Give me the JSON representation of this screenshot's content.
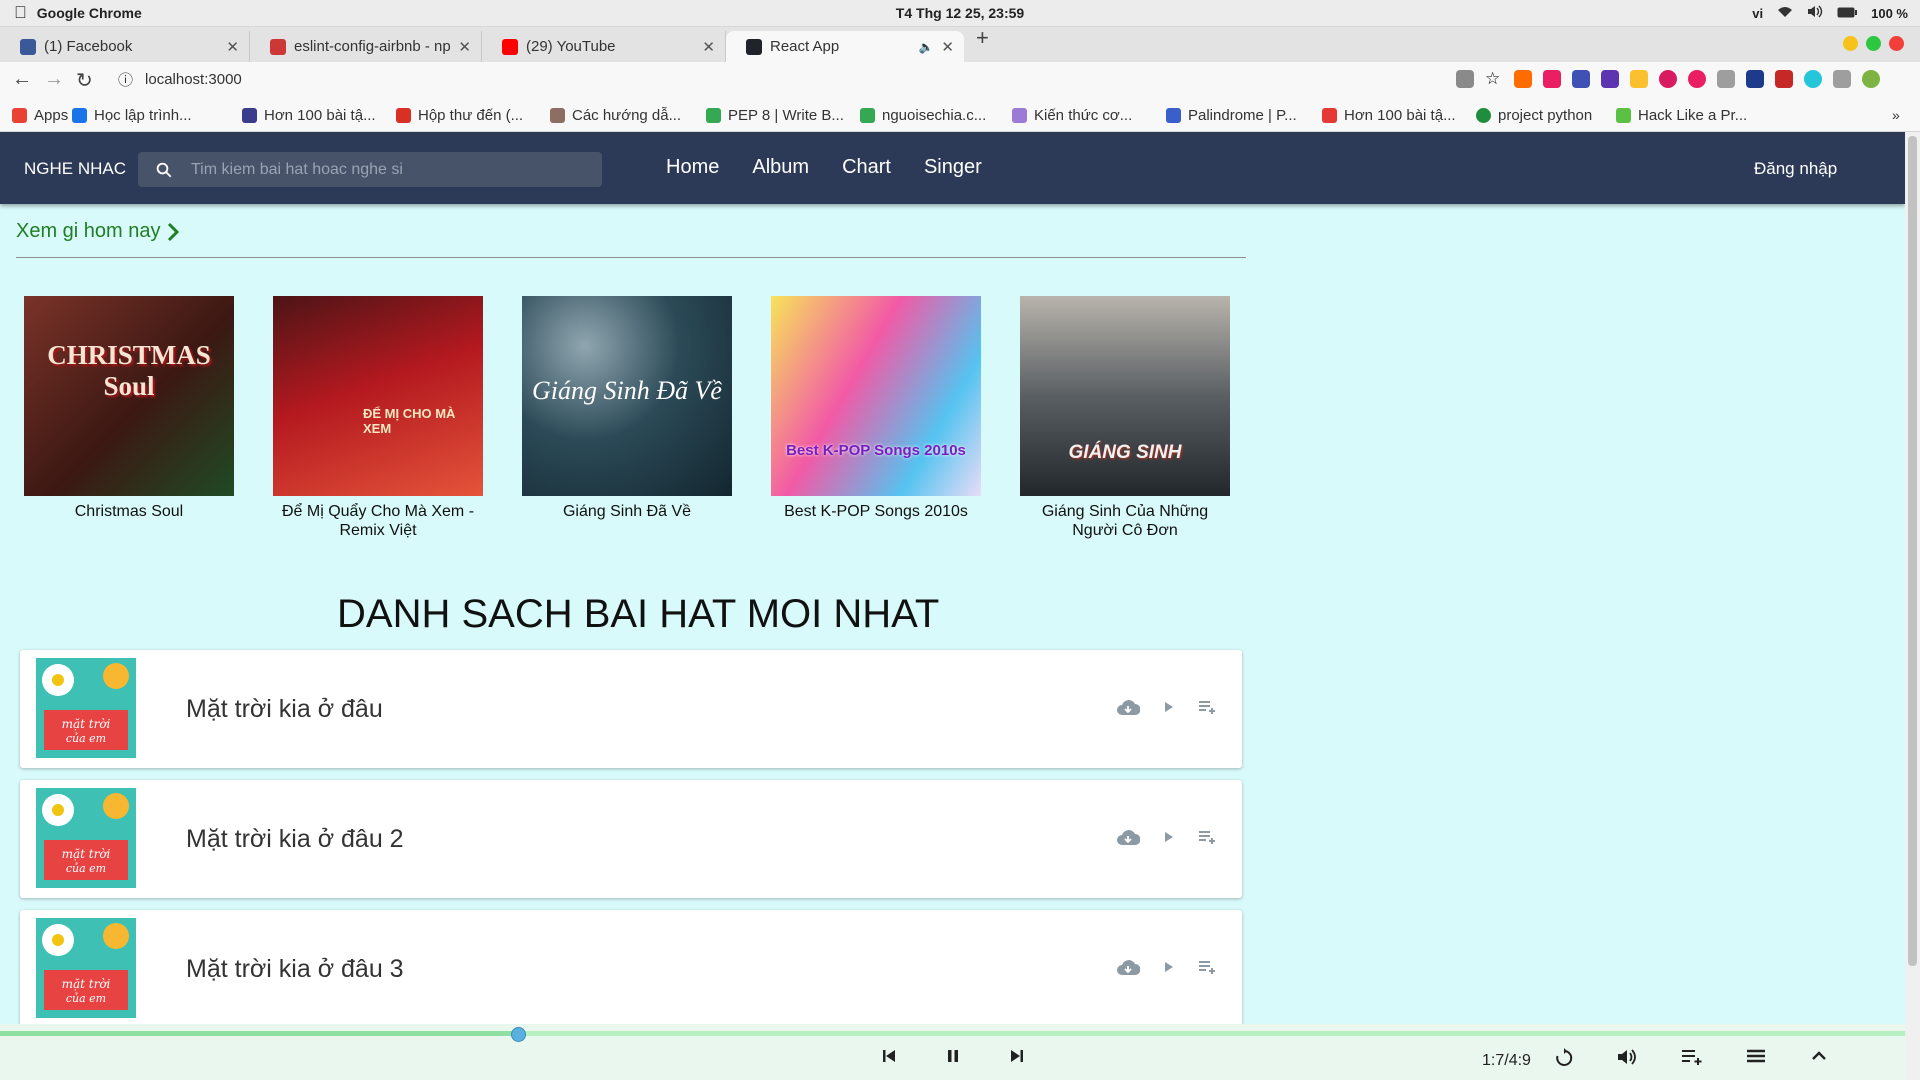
{
  "os": {
    "app_name": "Google Chrome",
    "clock": "T4 Thg 12 25, 23:59",
    "lang": "vi",
    "battery": "100 %"
  },
  "tabs": [
    {
      "label": "(1) Facebook",
      "color": "#3b5998"
    },
    {
      "label": "eslint-config-airbnb - npm",
      "color": "#cb3837"
    },
    {
      "label": "(29) YouTube",
      "color": "#ff0000"
    },
    {
      "label": "React App",
      "color": "#20232a"
    }
  ],
  "url": "localhost:3000",
  "bookmarks": [
    {
      "label": "Apps",
      "color": "#e94235"
    },
    {
      "label": "Học lập trình...",
      "color": "#1a73e8"
    },
    {
      "label": "Hơn 100 bài tậ...",
      "color": "#3c3c8c"
    },
    {
      "label": "Hộp thư đến (...",
      "color": "#d93025"
    },
    {
      "label": "Các hướng dẫ...",
      "color": "#8d6e63"
    },
    {
      "label": "PEP 8 | Write B...",
      "color": "#34a853"
    },
    {
      "label": "nguoisechia.c...",
      "color": "#34a853"
    },
    {
      "label": "Kiến thức cơ...",
      "color": "#9c7bd6"
    },
    {
      "label": "Palindrome | P...",
      "color": "#3b5fc9"
    },
    {
      "label": "Hơn 100 bài tậ...",
      "color": "#e53935"
    },
    {
      "label": "project python",
      "color": "#1e8e3e"
    },
    {
      "label": "Hack Like a Pr...",
      "color": "#5ac145"
    }
  ],
  "app": {
    "brand": "NGHE NHAC",
    "search_placeholder": "Tim kiem bai hat hoac nghe si",
    "nav": [
      "Home",
      "Album",
      "Chart",
      "Singer"
    ],
    "login": "Đăng nhập",
    "section_title": "Xem gi hom nay",
    "albums": [
      {
        "title": "Christmas Soul",
        "art_text": "CHRISTMAS Soul",
        "bg": "#6a2b22"
      },
      {
        "title": "Để Mị Quẩy Cho Mà Xem - Remix Việt",
        "art_text": "ĐỂ MỊ CHO MÀ XEM",
        "bg": "#a31b1f"
      },
      {
        "title": "Giáng Sinh Đã Về",
        "art_text": "Giáng Sinh Đã Về",
        "bg": "#1f3f4f"
      },
      {
        "title": "Best K-POP Songs 2010s",
        "art_text": "Best K-POP Songs 2010s",
        "bg": "#e9e2f2"
      },
      {
        "title": "Giáng Sinh Của Những Người Cô Đơn",
        "art_text": "GIÁNG SINH",
        "bg": "#40474d"
      }
    ],
    "list_title": "DANH SACH BAI HAT MOI NHAT",
    "songs": [
      {
        "name": "Mặt trời kia ở đâu"
      },
      {
        "name": "Mặt trời kia ở đâu 2"
      },
      {
        "name": "Mặt trời kia ở đâu 3"
      }
    ]
  },
  "player": {
    "time": "1:7/4:9",
    "progress": 0.272
  }
}
